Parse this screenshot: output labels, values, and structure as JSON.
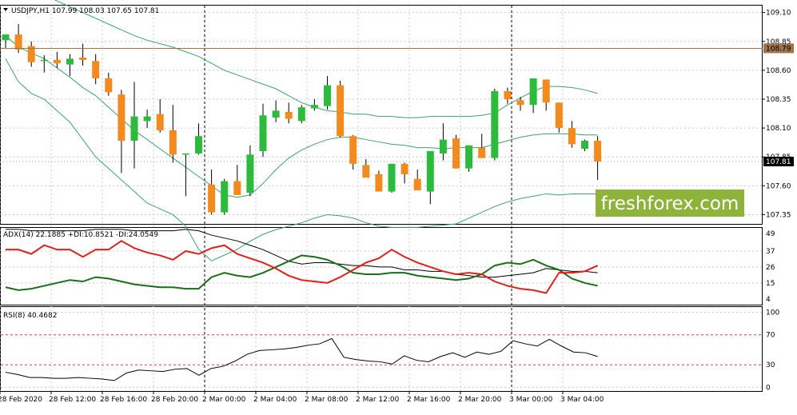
{
  "main": {
    "symbol_caption": "USDJPY,H1  107.99 108.03 107.65 107.81",
    "price_ticks": [
      "109.10",
      "108.85",
      "108.60",
      "108.35",
      "108.10",
      "107.85",
      "107.60",
      "107.35"
    ],
    "hline_label": "108.79",
    "last_price_label": "107.81",
    "watermark": "freshforex.com"
  },
  "adx": {
    "caption": "ADX(14) 22.1885 +DI:10.8521 -DI:24.0549",
    "ticks": [
      "49",
      "37",
      "26",
      "15",
      "4"
    ]
  },
  "rsi": {
    "caption": "RSI(8) 40.4682",
    "ticks": [
      "100",
      "70",
      "30",
      "0"
    ]
  },
  "time_ticks": [
    "28 Feb 2020",
    "28 Feb 12:00",
    "28 Feb 16:00",
    "28 Feb 20:00",
    "2 Mar 00:00",
    "2 Mar 04:00",
    "2 Mar 08:00",
    "2 Mar 12:00",
    "2 Mar 16:00",
    "2 Mar 20:00",
    "3 Mar 00:00",
    "3 Mar 04:00"
  ],
  "colors": {
    "bull": "#2dbb3e",
    "bear": "#f28a1e",
    "wick": "#000000",
    "bands": "#3da36a",
    "hline": "#a0724a",
    "watermark_bg": "#8db33a",
    "plus_di": "#1a6e1a",
    "minus_di": "#e0201a",
    "adx_line": "#000000",
    "rsi_line": "#000000",
    "rsi_levels": "#d04040",
    "grid": "#c8c8c8"
  },
  "chart_data": [
    {
      "type": "candlestick",
      "title": "USDJPY,H1",
      "ylim": [
        107.27,
        109.16
      ],
      "candles": [
        {
          "o": 108.86,
          "h": 108.91,
          "l": 108.79,
          "c": 108.91
        },
        {
          "o": 108.91,
          "h": 109.0,
          "l": 108.75,
          "c": 108.78
        },
        {
          "o": 108.81,
          "h": 108.85,
          "l": 108.63,
          "c": 108.67
        },
        {
          "o": 108.69,
          "h": 108.73,
          "l": 108.58,
          "c": 108.69
        },
        {
          "o": 108.69,
          "h": 108.76,
          "l": 108.62,
          "c": 108.66
        },
        {
          "o": 108.65,
          "h": 108.74,
          "l": 108.55,
          "c": 108.7
        },
        {
          "o": 108.71,
          "h": 108.83,
          "l": 108.64,
          "c": 108.69
        },
        {
          "o": 108.68,
          "h": 108.74,
          "l": 108.48,
          "c": 108.53
        },
        {
          "o": 108.53,
          "h": 108.58,
          "l": 108.38,
          "c": 108.41
        },
        {
          "o": 108.39,
          "h": 108.43,
          "l": 107.71,
          "c": 107.99
        },
        {
          "o": 107.99,
          "h": 108.5,
          "l": 107.75,
          "c": 108.2
        },
        {
          "o": 108.16,
          "h": 108.26,
          "l": 108.1,
          "c": 108.2
        },
        {
          "o": 108.22,
          "h": 108.35,
          "l": 108.06,
          "c": 108.08
        },
        {
          "o": 108.08,
          "h": 108.3,
          "l": 107.8,
          "c": 107.87
        },
        {
          "o": 107.87,
          "h": 107.87,
          "l": 107.51,
          "c": 107.88
        },
        {
          "o": 107.88,
          "h": 108.14,
          "l": 107.87,
          "c": 108.03
        },
        {
          "o": 107.61,
          "h": 107.74,
          "l": 107.35,
          "c": 107.37
        },
        {
          "o": 107.37,
          "h": 107.66,
          "l": 107.35,
          "c": 107.64
        },
        {
          "o": 107.64,
          "h": 107.78,
          "l": 107.54,
          "c": 107.52
        },
        {
          "o": 107.54,
          "h": 107.95,
          "l": 107.51,
          "c": 107.87
        },
        {
          "o": 107.9,
          "h": 108.31,
          "l": 107.85,
          "c": 108.21
        },
        {
          "o": 108.19,
          "h": 108.34,
          "l": 108.15,
          "c": 108.25
        },
        {
          "o": 108.24,
          "h": 108.32,
          "l": 108.14,
          "c": 108.18
        },
        {
          "o": 108.16,
          "h": 108.3,
          "l": 108.14,
          "c": 108.28
        },
        {
          "o": 108.27,
          "h": 108.35,
          "l": 108.25,
          "c": 108.3
        },
        {
          "o": 108.29,
          "h": 108.55,
          "l": 108.26,
          "c": 108.47
        },
        {
          "o": 108.47,
          "h": 108.51,
          "l": 108.02,
          "c": 108.03
        },
        {
          "o": 108.03,
          "h": 108.04,
          "l": 107.74,
          "c": 107.79
        },
        {
          "o": 107.78,
          "h": 107.83,
          "l": 107.7,
          "c": 107.67
        },
        {
          "o": 107.7,
          "h": 107.73,
          "l": 107.55,
          "c": 107.55
        },
        {
          "o": 107.55,
          "h": 107.79,
          "l": 107.54,
          "c": 107.79
        },
        {
          "o": 107.79,
          "h": 107.8,
          "l": 107.62,
          "c": 107.7
        },
        {
          "o": 107.66,
          "h": 107.74,
          "l": 107.56,
          "c": 107.56
        },
        {
          "o": 107.55,
          "h": 107.9,
          "l": 107.44,
          "c": 107.9
        },
        {
          "o": 107.88,
          "h": 108.14,
          "l": 107.82,
          "c": 108.0
        },
        {
          "o": 108.01,
          "h": 108.04,
          "l": 107.75,
          "c": 107.75
        },
        {
          "o": 107.75,
          "h": 107.95,
          "l": 107.72,
          "c": 107.95
        },
        {
          "o": 107.93,
          "h": 108.05,
          "l": 107.85,
          "c": 107.84
        },
        {
          "o": 107.84,
          "h": 108.44,
          "l": 107.82,
          "c": 108.42
        },
        {
          "o": 108.42,
          "h": 108.45,
          "l": 108.31,
          "c": 108.35
        },
        {
          "o": 108.34,
          "h": 108.37,
          "l": 108.25,
          "c": 108.3
        },
        {
          "o": 108.3,
          "h": 108.53,
          "l": 108.23,
          "c": 108.53
        },
        {
          "o": 108.52,
          "h": 108.52,
          "l": 108.25,
          "c": 108.32
        },
        {
          "o": 108.32,
          "h": 108.32,
          "l": 108.06,
          "c": 108.1
        },
        {
          "o": 108.1,
          "h": 108.16,
          "l": 107.93,
          "c": 107.96
        },
        {
          "o": 107.92,
          "h": 108.0,
          "l": 107.9,
          "c": 107.99
        },
        {
          "o": 107.99,
          "h": 108.03,
          "l": 107.65,
          "c": 107.81
        }
      ],
      "bollinger_upper": [
        109.4,
        109.35,
        109.3,
        109.25,
        109.2,
        109.15,
        109.1,
        109.05,
        109.0,
        108.95,
        108.9,
        108.86,
        108.83,
        108.8,
        108.76,
        108.72,
        108.66,
        108.6,
        108.56,
        108.52,
        108.48,
        108.44,
        108.38,
        108.32,
        108.28,
        108.25,
        108.24,
        108.22,
        108.22,
        108.2,
        108.2,
        108.19,
        108.19,
        108.2,
        108.2,
        108.2,
        108.2,
        108.21,
        108.23,
        108.3,
        108.36,
        108.42,
        108.46,
        108.46,
        108.45,
        108.43,
        108.4
      ],
      "bollinger_middle": [
        108.9,
        108.8,
        108.75,
        108.7,
        108.62,
        108.54,
        108.45,
        108.38,
        108.28,
        108.18,
        108.08,
        108.0,
        107.92,
        107.84,
        107.76,
        107.68,
        107.6,
        107.52,
        107.5,
        107.52,
        107.62,
        107.74,
        107.84,
        107.91,
        107.96,
        108.0,
        108.02,
        108.02,
        108.0,
        107.98,
        107.96,
        107.95,
        107.93,
        107.93,
        107.92,
        107.93,
        107.93,
        107.93,
        107.96,
        107.99,
        108.02,
        108.04,
        108.05,
        108.05,
        108.05,
        108.04,
        108.04
      ],
      "bollinger_lower": [
        108.7,
        108.5,
        108.4,
        108.35,
        108.25,
        108.15,
        108.0,
        107.85,
        107.75,
        107.65,
        107.55,
        107.45,
        107.4,
        107.35,
        107.25,
        107.05,
        106.95,
        107.0,
        107.05,
        107.12,
        107.18,
        107.22,
        107.25,
        107.28,
        107.32,
        107.35,
        107.34,
        107.32,
        107.28,
        107.25,
        107.24,
        107.24,
        107.24,
        107.25,
        107.26,
        107.27,
        107.32,
        107.37,
        107.42,
        107.46,
        107.49,
        107.51,
        107.53,
        107.52,
        107.53,
        107.53,
        107.53
      ],
      "horizontal_line": 108.79,
      "last_price": 107.81
    },
    {
      "type": "line",
      "title": "ADX(14) 22.1885 +DI:10.8521 -DI:24.0549",
      "ylim": [
        0,
        53
      ],
      "series": [
        {
          "name": "ADX",
          "values": [
            52,
            52,
            51,
            51,
            51,
            51,
            51,
            52,
            52,
            52,
            51,
            51,
            51,
            51,
            52,
            51,
            48,
            46,
            44,
            41,
            38,
            34,
            30,
            28,
            29,
            29,
            28,
            27,
            27,
            26,
            26,
            24,
            24,
            23,
            23,
            21,
            20,
            19,
            19,
            20,
            21,
            22,
            25,
            24,
            23,
            23,
            22
          ]
        },
        {
          "name": "+DI",
          "values": [
            12,
            10,
            11,
            13,
            15,
            17,
            16,
            19,
            18,
            16,
            14,
            13,
            12,
            12,
            11,
            11,
            19,
            22,
            20,
            19,
            22,
            26,
            30,
            34,
            33,
            31,
            27,
            22,
            21,
            21,
            22,
            22,
            20,
            19,
            18,
            17,
            18,
            21,
            27,
            29,
            28,
            31,
            27,
            24,
            18,
            15,
            13
          ]
        },
        {
          "name": "-DI",
          "values": [
            38,
            38,
            35,
            41,
            38,
            38,
            33,
            38,
            38,
            44,
            39,
            36,
            34,
            31,
            37,
            35,
            39,
            41,
            35,
            32,
            29,
            25,
            20,
            17,
            16,
            15,
            19,
            24,
            29,
            32,
            38,
            33,
            29,
            26,
            23,
            21,
            22,
            21,
            16,
            13,
            11,
            10,
            8,
            22,
            22,
            23,
            27
          ]
        }
      ]
    },
    {
      "type": "line",
      "title": "RSI(8) 40.4682",
      "ylim": [
        -5,
        107
      ],
      "levels": [
        70,
        30
      ],
      "series": [
        {
          "name": "RSI",
          "values": [
            20,
            17,
            13,
            13,
            12,
            12,
            13,
            12,
            11,
            9,
            19,
            23,
            22,
            21,
            24,
            25,
            16,
            25,
            28,
            35,
            44,
            49,
            50,
            51,
            53,
            56,
            58,
            65,
            40,
            37,
            35,
            34,
            31,
            42,
            36,
            34,
            41,
            46,
            40,
            47,
            44,
            48,
            62,
            58,
            55,
            64,
            55,
            47,
            46,
            41
          ]
        }
      ]
    }
  ]
}
